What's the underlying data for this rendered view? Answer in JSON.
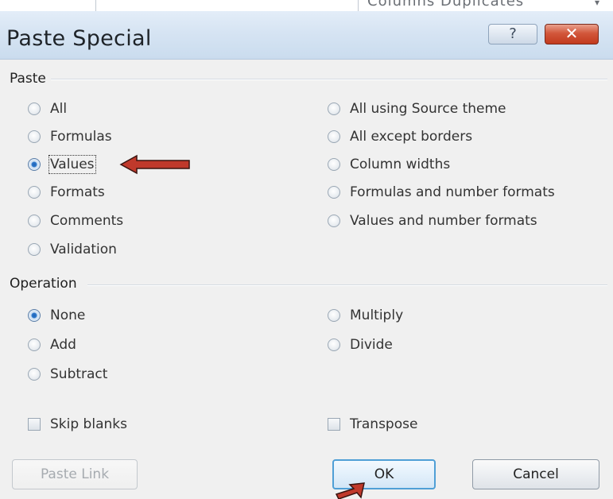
{
  "background": {
    "partial_text": "Columns Duplicates"
  },
  "dialog": {
    "title": "Paste Special",
    "help_glyph": "?",
    "close_glyph": "✕"
  },
  "paste": {
    "label": "Paste",
    "options_left": [
      "All",
      "Formulas",
      "Values",
      "Formats",
      "Comments",
      "Validation"
    ],
    "options_right": [
      "All using Source theme",
      "All except borders",
      "Column widths",
      "Formulas and number formats",
      "Values and number formats"
    ],
    "selected": "Values"
  },
  "operation": {
    "label": "Operation",
    "options_left": [
      "None",
      "Add",
      "Subtract"
    ],
    "options_right": [
      "Multiply",
      "Divide"
    ],
    "selected": "None"
  },
  "checkboxes": {
    "skip_blanks": "Skip blanks",
    "transpose": "Transpose"
  },
  "buttons": {
    "paste_link": "Paste Link",
    "ok": "OK",
    "cancel": "Cancel"
  },
  "colors": {
    "annotation_arrow": "#c0392b",
    "close_button": "#c23a1d",
    "default_button_border": "#4f9fd6"
  }
}
